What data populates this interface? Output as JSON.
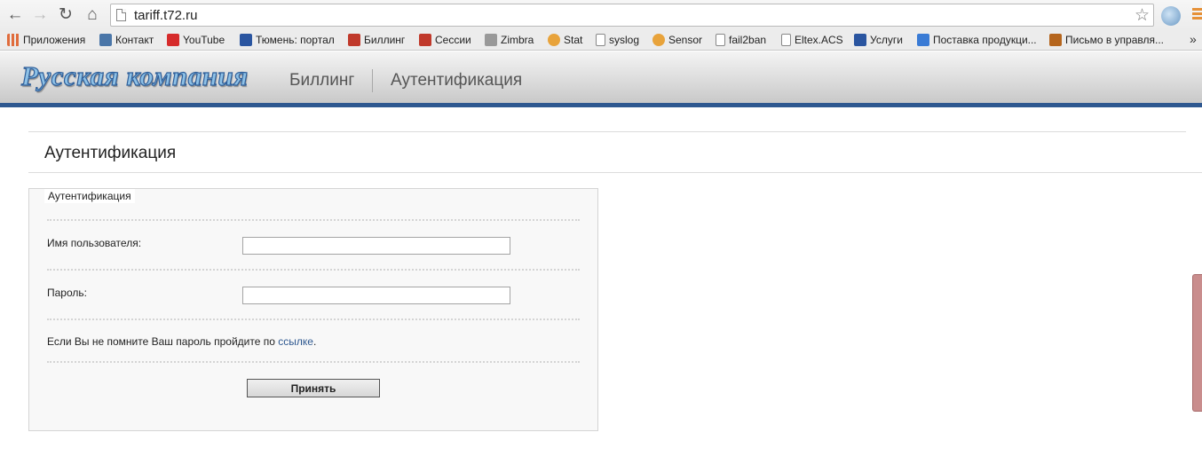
{
  "browser": {
    "url": "tariff.t72.ru",
    "back_icon": "arrow-left-icon",
    "forward_icon": "arrow-right-icon",
    "reload_icon": "reload-icon",
    "home_icon": "home-icon",
    "bookmark_star_icon": "star-icon",
    "bookmarks": [
      {
        "label": "Приложения",
        "icon": "apps-grid-icon",
        "color": "#e06c3c"
      },
      {
        "label": "Контакт",
        "icon": "vk-icon",
        "color": "#4a76a8"
      },
      {
        "label": "YouTube",
        "icon": "youtube-icon",
        "color": "#d62b2b"
      },
      {
        "label": "Тюмень: портал",
        "icon": "crest-icon",
        "color": "#2a55a0"
      },
      {
        "label": "Биллинг",
        "icon": "billing-icon",
        "color": "#c0392b"
      },
      {
        "label": "Сессии",
        "icon": "sessions-icon",
        "color": "#c0392b"
      },
      {
        "label": "Zimbra",
        "icon": "zimbra-icon",
        "color": "#888888"
      },
      {
        "label": "Stat",
        "icon": "gauge-icon",
        "color": "#e8a33b"
      },
      {
        "label": "syslog",
        "icon": "page-icon",
        "color": "#ffffff"
      },
      {
        "label": "Sensor",
        "icon": "gauge-icon",
        "color": "#e8a33b"
      },
      {
        "label": "fail2ban",
        "icon": "page-icon",
        "color": "#ffffff"
      },
      {
        "label": "Eltex.ACS",
        "icon": "page-icon",
        "color": "#ffffff"
      },
      {
        "label": "Услуги",
        "icon": "crest-icon",
        "color": "#2a55a0"
      },
      {
        "label": "Поставка продукци...",
        "icon": "check-icon",
        "color": "#3a7bd5"
      },
      {
        "label": "Письмо в управля...",
        "icon": "letter-icon",
        "color": "#b5651d"
      }
    ],
    "overflow": "»"
  },
  "site": {
    "logo_text": "Русская компания",
    "nav": [
      {
        "label": "Биллинг"
      },
      {
        "label": "Аутентификация"
      }
    ]
  },
  "page": {
    "title": "Аутентификация"
  },
  "form": {
    "legend": "Аутентификация",
    "username_label": "Имя пользователя:",
    "username_value": "",
    "password_label": "Пароль:",
    "password_value": "",
    "note_prefix": "Если Вы не помните Ваш пароль пройдите по ",
    "note_link": "ссылке",
    "note_suffix": ".",
    "submit_label": "Принять"
  }
}
